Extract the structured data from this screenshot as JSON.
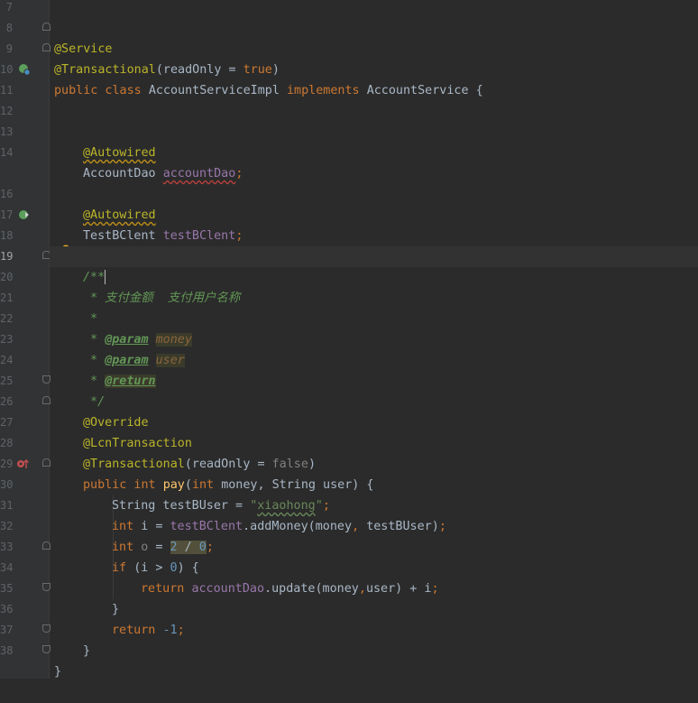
{
  "gutter": {
    "line_numbers": [
      "7",
      "8",
      "9",
      "10",
      "11",
      "12",
      "13",
      "14",
      "16",
      "17",
      "18",
      "19",
      "20",
      "21",
      "22",
      "23",
      "24",
      "25",
      "26",
      "27",
      "28",
      "29",
      "30",
      "31",
      "32",
      "33",
      "34",
      "35",
      "36",
      "37",
      "38"
    ]
  },
  "code": {
    "l8": "@Service",
    "l9_ann": "@Transactional",
    "l9_a": "(readOnly = ",
    "l9_val": "true",
    "l9_b": ")",
    "l10_kw1": "public class ",
    "l10_name": "AccountServiceImpl ",
    "l10_kw2": "implements ",
    "l10_iface": "AccountService {",
    "l13": "@Autowired",
    "l14_type": "AccountDao ",
    "l14_field": "accountDao",
    "l14_semi": ";",
    "l16": "@Autowired",
    "l17_type": "TestBClent ",
    "l17_field": "testBClent",
    "l17_semi": ";",
    "l19": "/**",
    "l20": " * 支付金额  支付用户名称",
    "l21": " *",
    "l22_pre": " * ",
    "l22_tag": "@param",
    "l22_sp": " ",
    "l22_name": "money",
    "l23_pre": " * ",
    "l23_tag": "@param",
    "l23_sp": " ",
    "l23_name": "user",
    "l24_pre": " * ",
    "l24_tag": "@return",
    "l25": " */",
    "l26": "@Override",
    "l27": "@LcnTransaction",
    "l28_ann": "@Transactional",
    "l28_a": "(readOnly = ",
    "l28_val": "false",
    "l28_b": ")",
    "l29_kw": "public int ",
    "l29_name": "pay",
    "l29_p1": "(",
    "l29_kw2": "int ",
    "l29_p2": "money, String user) {",
    "l30_a": "String testBUser = ",
    "l30_q1": "\"",
    "l30_str": "xiaohong",
    "l30_q2": "\"",
    "l30_semi": ";",
    "l31_kw": "int ",
    "l31_a": "i = ",
    "l31_field": "testBClent",
    "l31_b": ".addMoney(money",
    "l31_c": ", ",
    "l31_d": "testBUser)",
    "l31_semi": ";",
    "l32_kw": "int ",
    "l32_var": "o",
    "l32_eq": " = ",
    "l32_n1": "2",
    "l32_op": " / ",
    "l32_n2": "0",
    "l32_semi": ";",
    "l33_kw": "if ",
    "l33_a": "(i > ",
    "l33_n": "0",
    "l33_b": ") {",
    "l34_kw": "return ",
    "l34_field": "accountDao",
    "l34_a": ".update(money",
    "l34_c": ",",
    "l34_b": "user) + i",
    "l34_semi": ";",
    "l35": "}",
    "l36_kw": "return ",
    "l36_n": "-1",
    "l36_semi": ";",
    "l37": "}",
    "l38": "}"
  },
  "icons": {
    "bean": "spring-bean-icon",
    "autowire": "autowired-navigate-icon",
    "override": "override-method-icon",
    "bulb": "intention-bulb-icon"
  },
  "colors": {
    "background": "#2b2b2b",
    "keyword": "#cc7832",
    "annotation": "#bbb529",
    "string": "#6a8759",
    "number": "#6897bb",
    "field": "#9876aa",
    "doc": "#629755"
  }
}
